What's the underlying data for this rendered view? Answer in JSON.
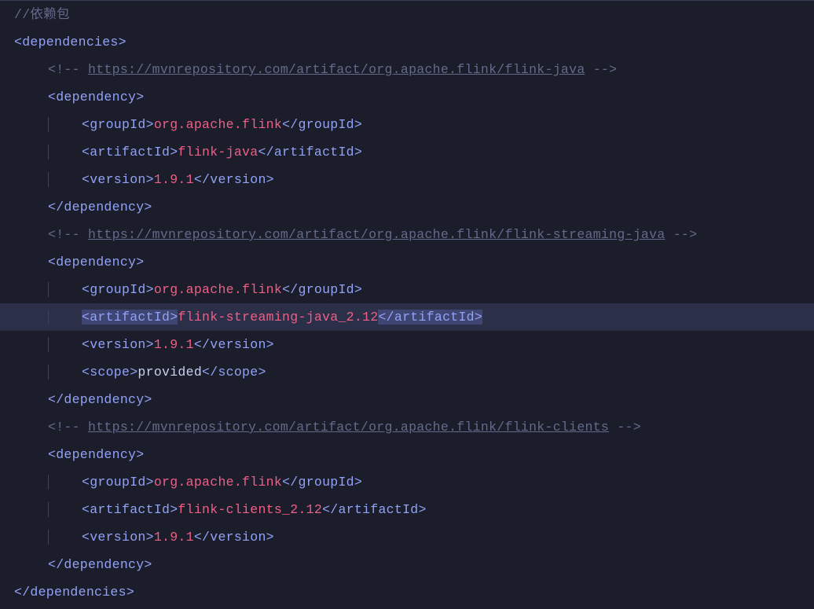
{
  "comment_header_slashes": "//",
  "comment_header_text": "依赖包",
  "tags": {
    "deps_open": "<dependencies>",
    "deps_close": "</dependencies>",
    "dep_open": "<dependency>",
    "dep_close": "</dependency>",
    "gid_open": "<groupId>",
    "gid_close": "</groupId>",
    "aid_open": "<artifactId>",
    "aid_close": "</artifactId>",
    "ver_open": "<version>",
    "ver_close": "</version>",
    "scope_open": "<scope>",
    "scope_close": "</scope>"
  },
  "comment_prefix": "<!-- ",
  "comment_suffix": " -->",
  "urls": {
    "u1": "https://mvnrepository.com/artifact/org.apache.flink/flink-java",
    "u2": "https://mvnrepository.com/artifact/org.apache.flink/flink-streaming-java",
    "u3": "https://mvnrepository.com/artifact/org.apache.flink/flink-clients"
  },
  "dep1": {
    "groupId": "org.apache.flink",
    "artifactId": "flink-java",
    "version": "1.9.1"
  },
  "dep2": {
    "groupId": "org.apache.flink",
    "artifactId": "flink-streaming-java_2.12",
    "version": "1.9.1",
    "scope": "provided"
  },
  "dep3": {
    "groupId": "org.apache.flink",
    "artifactId": "flink-clients_2.12",
    "version": "1.9.1"
  }
}
